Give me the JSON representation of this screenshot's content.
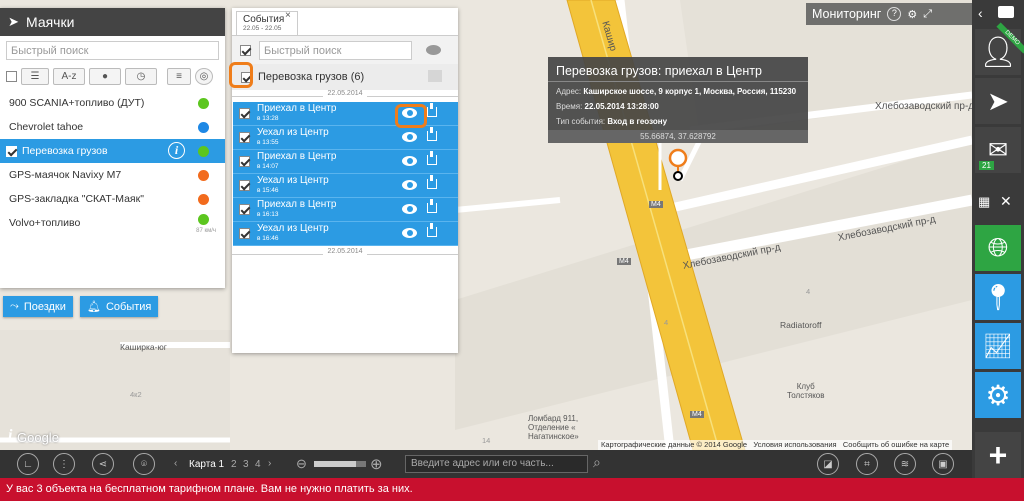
{
  "panel_beacons": {
    "title": "Маячки",
    "search_placeholder": "Быстрый поиск",
    "sort_az": "A-z",
    "vehicles": [
      {
        "name": "900 SCANIA+топливо (ДУТ)",
        "color": "#5cc61f"
      },
      {
        "name": "Chevrolet tahoe",
        "color": "#1e88e5"
      },
      {
        "name": "Перевозка грузов",
        "color": "#5cc61f"
      },
      {
        "name": "GPS-маячок Navixy M7",
        "color": "#f26b1d"
      },
      {
        "name": "GPS-закладка \"СКАТ-Маяк\"",
        "color": "#f26b1d"
      },
      {
        "name": "Volvo+топливо",
        "color": "#5cc61f"
      }
    ],
    "speed": "87 км/ч",
    "trips_button": "Поездки",
    "events_button": "События"
  },
  "panel_events": {
    "tab_title": "События",
    "tab_sub": "22.05 - 22.05",
    "search_placeholder": "Быстрый поиск",
    "group": "Перевозка грузов (6)",
    "date1": "22.05.2014",
    "date2": "22.05.2014",
    "events": [
      {
        "title": "Приехал в Центр",
        "time": "в 13:28"
      },
      {
        "title": "Уехал из Центр",
        "time": "в 13:55"
      },
      {
        "title": "Приехал в Центр",
        "time": "в 14:07"
      },
      {
        "title": "Уехал из Центр",
        "time": "в 15:46"
      },
      {
        "title": "Приехал в Центр",
        "time": "в 16:13"
      },
      {
        "title": "Уехал из Центр",
        "time": "в 16:46"
      }
    ]
  },
  "tooltip": {
    "title": "Перевозка грузов: приехал в Центр",
    "address_label": "Адрес:",
    "address": "Каширское шоссе, 9 корпус 1, Москва, Россия, 115230",
    "time_label": "Время:",
    "time": "22.05.2014 13:28:00",
    "type_label": "Тип события:",
    "type": "Вход в геозону",
    "coords": "55.66874, 37.628792"
  },
  "header": {
    "title": "Мониторинг",
    "help": "?"
  },
  "map_labels": {
    "street1": "Хлебозаводский пр-д",
    "street2": "Хлебозаводский пр-д",
    "street3": "Хлебозаводский пр-д",
    "kashir": "Кашир",
    "m4a": "М4",
    "m4b": "М4",
    "m4c": "М4",
    "radiator": "Radiatoroff",
    "klub": "Клуб\nТолстяков",
    "kashirka": "Каширка-юг",
    "lombard": "Ломбард 911,\nОтделение «\nНагатинское»",
    "b4k2": "4к2",
    "b14": "14",
    "b4": "4",
    "b4b": "4",
    "google": "Google"
  },
  "copyright": {
    "data": "Картографические данные © 2014 Google",
    "terms": "Условия использования",
    "report": "Сообщить об ошибке на карте"
  },
  "bottom": {
    "map_label": "Карта 1",
    "maps": [
      "2",
      "3",
      "4"
    ],
    "address_placeholder": "Введите адрес или его часть...",
    "zoom_level": 0.8
  },
  "sidebar": {
    "messages_badge": "21",
    "demo": "DEMO"
  },
  "alert": "У вас 3 объекта на бесплатном тарифном плане. Вам не нужно платить за них.",
  "colors": {
    "accent": "#2c9be3",
    "green": "#2ea543",
    "orange": "#ef7d1a",
    "alert": "#c8102e"
  }
}
